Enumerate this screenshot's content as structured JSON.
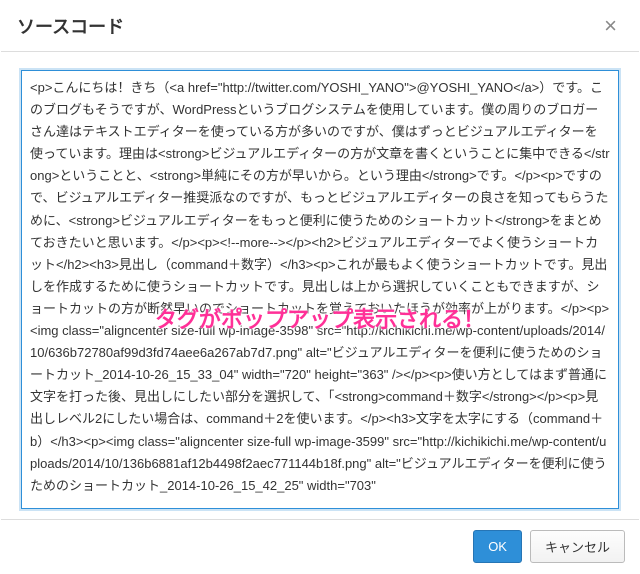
{
  "header": {
    "title": "ソースコード",
    "close_icon": "×"
  },
  "body": {
    "source_code": "<p>こんにちは！きち（<a href=\"http://twitter.com/YOSHI_YANO\">@YOSHI_YANO</a>）です。このブログもそうですが、WordPressというブログシステムを使用しています。僕の周りのブロガーさん達はテキストエディターを使っている方が多いのですが、僕はずっとビジュアルエディターを使っています。理由は<strong>ビジュアルエディターの方が文章を書くということに集中できる</strong>ということと、<strong>単純にその方が早いから。という理由</strong>です。</p><p>ですので、ビジュアルエディター推奨派なのですが、もっとビジュアルエディターの良さを知ってもらうために、<strong>ビジュアルエディターをもっと便利に使うためのショートカット</strong>をまとめておきたいと思います。</p><p><!--more--></p><h2>ビジュアルエディターでよく使うショートカット</h2><h3>見出し（command＋数字）</h3><p>これが最もよく使うショートカットです。見出しを作成するために使うショートカットです。見出しは上から選択していくこともできますが、ショートカットの方が断然早いのでショートカットを覚えておいたほうが効率が上がります。</p><p><img class=\"aligncenter size-full wp-image-3598\" src=\"http://kichikichi.me/wp-content/uploads/2014/10/636b72780af99d3fd74aee6a267ab7d7.png\" alt=\"ビジュアルエディターを便利に使うためのショートカット_2014-10-26_15_33_04\" width=\"720\" height=\"363\" /></p><p>使い方としてはまず普通に文字を打った後、見出しにしたい部分を選択して、「<strong>command＋数字</strong></p><p>見出しレベル2にしたい場合は、command＋2を使います。</p><h3>文字を太字にする（command＋b）</h3><p><img class=\"aligncenter size-full wp-image-3599\" src=\"http://kichikichi.me/wp-content/uploads/2014/10/136b6881af12b4498f2aec771144b18f.png\" alt=\"ビジュアルエディターを便利に使うためのショートカット_2014-10-26_15_42_25\" width=\"703\"",
    "overlay_note": "タグがポップアップ表示される！"
  },
  "footer": {
    "ok_label": "OK",
    "cancel_label": "キャンセル"
  }
}
